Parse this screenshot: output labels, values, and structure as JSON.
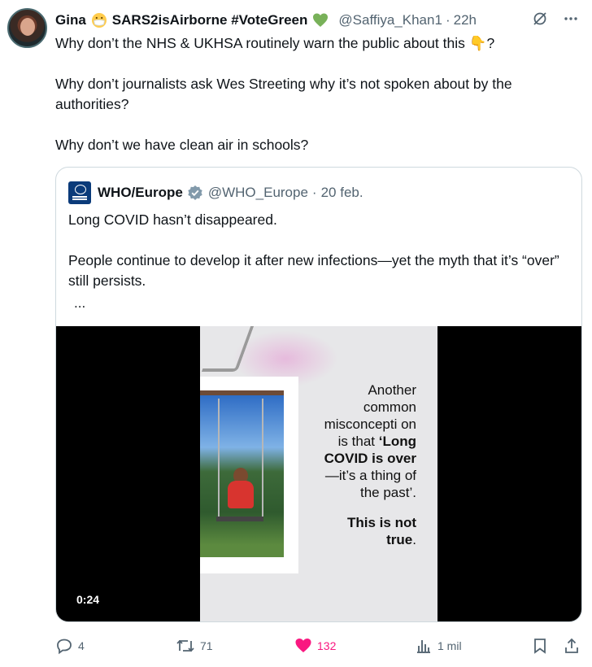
{
  "post": {
    "author_name": "Gina",
    "author_name_rest": "SARS2isAirborne #VoteGreen",
    "handle": "@Saffiya_Khan1",
    "dot": "·",
    "time": "22h",
    "paragraphs": [
      "Why don’t the NHS & UKHSA routinely warn the public about this 👇?",
      "Why don’t journalists ask Wes Streeting why it’s not spoken about by the authorities?",
      "Why don’t we have clean air in schools?"
    ]
  },
  "quote": {
    "author_name": "WHO/Europe",
    "handle": "@WHO_Europe",
    "dot": "·",
    "date": "20 feb.",
    "paragraphs": [
      "Long COVID hasn’t disappeared.",
      "People continue to develop it after new infections—yet the myth that it’s “over” still persists."
    ],
    "more": "...",
    "video": {
      "timestamp": "0:24",
      "slide": {
        "line1": "Another common misconcepti on is that",
        "bold1": "‘Long COVID is over",
        "rest1": "—it’s a thing of the past’.",
        "bold2": "This is not true",
        "rest2": "."
      }
    }
  },
  "actions": {
    "replies": "4",
    "reposts": "71",
    "likes": "132",
    "views": "1 mil"
  },
  "icons": {
    "more": "more-icon",
    "grok": "grok-icon",
    "reply": "reply-icon",
    "repost": "repost-icon",
    "like": "heart-icon",
    "views": "views-icon",
    "bookmark": "bookmark-icon",
    "share": "share-icon"
  },
  "colors": {
    "text": "#0f1419",
    "muted": "#536471",
    "like": "#f91880",
    "verified_grey": "#829aab",
    "green_heart": "#78b159"
  }
}
